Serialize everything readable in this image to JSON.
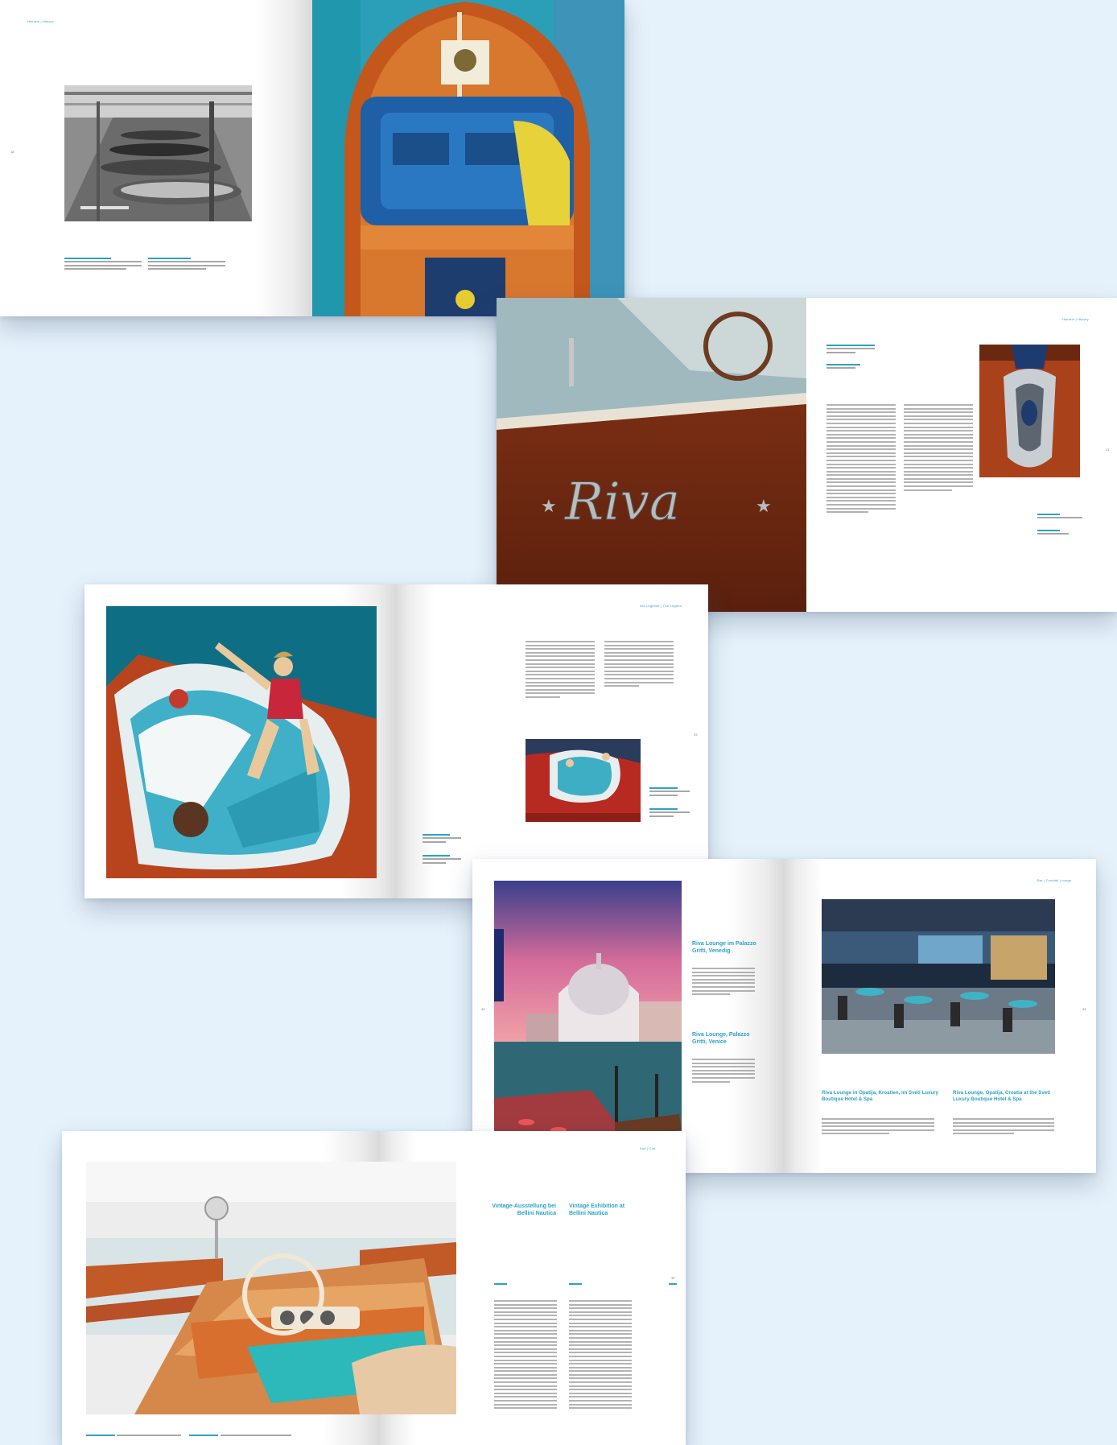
{
  "colors": {
    "background": "#e5f2fb",
    "accent": "#2aa3c6"
  },
  "spread1": {
    "header": "Historie | History",
    "page_number": "18",
    "photo_left": "black-and-white boatyard workshop photo",
    "photo_right": "wooden motorboat deck with open blue engine hatch"
  },
  "spread2": {
    "header": "Historie | History",
    "page_number": "21",
    "photo_left": "Riva logo on mahogany hull",
    "logo_text": "Riva",
    "photo_right": "chrome Riva bow emblem"
  },
  "spread3": {
    "header": "Die Legende | The Legend",
    "page_number": "29",
    "photo_left": "woman in red swimsuit seated in turquoise Riva with dog",
    "photo_right": "red Riva runabout on the water"
  },
  "spread4": {
    "header": "Bar | Cocktail Lounge",
    "page_left": "32",
    "page_right": "33",
    "heading1": "Riva Lounge im Palazzo Gritti, Venedig",
    "heading2": "Riva Lounge, Palazzo Gritti, Venice",
    "heading3": "Riva Lounge in Opatija, Kroatien, im Sveti Luxury Boutique Hotel & Spa",
    "heading4": "Riva Lounge, Opatija, Croatia at the Sveti Luxury Boutique Hotel & Spa",
    "photo_left": "Venice Santa Maria della Salute at sunset",
    "photo_right": "Riva lounge interior with turquoise chairs"
  },
  "spread5": {
    "header": "Kult | Cult",
    "page_number": "39",
    "heading_de": "Vintage-Ausstellung bei Bellini Nautica",
    "heading_en": "Vintage Exhibition at Bellini Nautica",
    "photo_left": "vintage Riva cockpit with steering wheel in showroom"
  }
}
